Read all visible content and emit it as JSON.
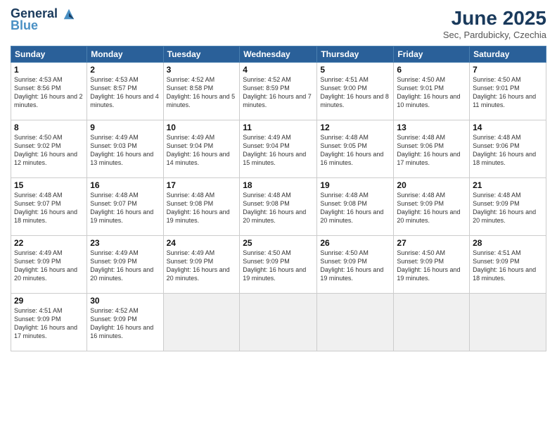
{
  "header": {
    "logo_line1": "General",
    "logo_line2": "Blue",
    "title": "June 2025",
    "subtitle": "Sec, Pardubicky, Czechia"
  },
  "weekdays": [
    "Sunday",
    "Monday",
    "Tuesday",
    "Wednesday",
    "Thursday",
    "Friday",
    "Saturday"
  ],
  "days": [
    {
      "num": "1",
      "sunrise": "4:53 AM",
      "sunset": "8:56 PM",
      "daylight": "16 hours and 2 minutes."
    },
    {
      "num": "2",
      "sunrise": "4:53 AM",
      "sunset": "8:57 PM",
      "daylight": "16 hours and 4 minutes."
    },
    {
      "num": "3",
      "sunrise": "4:52 AM",
      "sunset": "8:58 PM",
      "daylight": "16 hours and 5 minutes."
    },
    {
      "num": "4",
      "sunrise": "4:52 AM",
      "sunset": "8:59 PM",
      "daylight": "16 hours and 7 minutes."
    },
    {
      "num": "5",
      "sunrise": "4:51 AM",
      "sunset": "9:00 PM",
      "daylight": "16 hours and 8 minutes."
    },
    {
      "num": "6",
      "sunrise": "4:50 AM",
      "sunset": "9:01 PM",
      "daylight": "16 hours and 10 minutes."
    },
    {
      "num": "7",
      "sunrise": "4:50 AM",
      "sunset": "9:01 PM",
      "daylight": "16 hours and 11 minutes."
    },
    {
      "num": "8",
      "sunrise": "4:50 AM",
      "sunset": "9:02 PM",
      "daylight": "16 hours and 12 minutes."
    },
    {
      "num": "9",
      "sunrise": "4:49 AM",
      "sunset": "9:03 PM",
      "daylight": "16 hours and 13 minutes."
    },
    {
      "num": "10",
      "sunrise": "4:49 AM",
      "sunset": "9:04 PM",
      "daylight": "16 hours and 14 minutes."
    },
    {
      "num": "11",
      "sunrise": "4:49 AM",
      "sunset": "9:04 PM",
      "daylight": "16 hours and 15 minutes."
    },
    {
      "num": "12",
      "sunrise": "4:48 AM",
      "sunset": "9:05 PM",
      "daylight": "16 hours and 16 minutes."
    },
    {
      "num": "13",
      "sunrise": "4:48 AM",
      "sunset": "9:06 PM",
      "daylight": "16 hours and 17 minutes."
    },
    {
      "num": "14",
      "sunrise": "4:48 AM",
      "sunset": "9:06 PM",
      "daylight": "16 hours and 18 minutes."
    },
    {
      "num": "15",
      "sunrise": "4:48 AM",
      "sunset": "9:07 PM",
      "daylight": "16 hours and 18 minutes."
    },
    {
      "num": "16",
      "sunrise": "4:48 AM",
      "sunset": "9:07 PM",
      "daylight": "16 hours and 19 minutes."
    },
    {
      "num": "17",
      "sunrise": "4:48 AM",
      "sunset": "9:08 PM",
      "daylight": "16 hours and 19 minutes."
    },
    {
      "num": "18",
      "sunrise": "4:48 AM",
      "sunset": "9:08 PM",
      "daylight": "16 hours and 20 minutes."
    },
    {
      "num": "19",
      "sunrise": "4:48 AM",
      "sunset": "9:08 PM",
      "daylight": "16 hours and 20 minutes."
    },
    {
      "num": "20",
      "sunrise": "4:48 AM",
      "sunset": "9:09 PM",
      "daylight": "16 hours and 20 minutes."
    },
    {
      "num": "21",
      "sunrise": "4:48 AM",
      "sunset": "9:09 PM",
      "daylight": "16 hours and 20 minutes."
    },
    {
      "num": "22",
      "sunrise": "4:49 AM",
      "sunset": "9:09 PM",
      "daylight": "16 hours and 20 minutes."
    },
    {
      "num": "23",
      "sunrise": "4:49 AM",
      "sunset": "9:09 PM",
      "daylight": "16 hours and 20 minutes."
    },
    {
      "num": "24",
      "sunrise": "4:49 AM",
      "sunset": "9:09 PM",
      "daylight": "16 hours and 20 minutes."
    },
    {
      "num": "25",
      "sunrise": "4:50 AM",
      "sunset": "9:09 PM",
      "daylight": "16 hours and 19 minutes."
    },
    {
      "num": "26",
      "sunrise": "4:50 AM",
      "sunset": "9:09 PM",
      "daylight": "16 hours and 19 minutes."
    },
    {
      "num": "27",
      "sunrise": "4:50 AM",
      "sunset": "9:09 PM",
      "daylight": "16 hours and 19 minutes."
    },
    {
      "num": "28",
      "sunrise": "4:51 AM",
      "sunset": "9:09 PM",
      "daylight": "16 hours and 18 minutes."
    },
    {
      "num": "29",
      "sunrise": "4:51 AM",
      "sunset": "9:09 PM",
      "daylight": "16 hours and 17 minutes."
    },
    {
      "num": "30",
      "sunrise": "4:52 AM",
      "sunset": "9:09 PM",
      "daylight": "16 hours and 16 minutes."
    }
  ],
  "labels": {
    "sunrise": "Sunrise:",
    "sunset": "Sunset:",
    "daylight": "Daylight:"
  }
}
